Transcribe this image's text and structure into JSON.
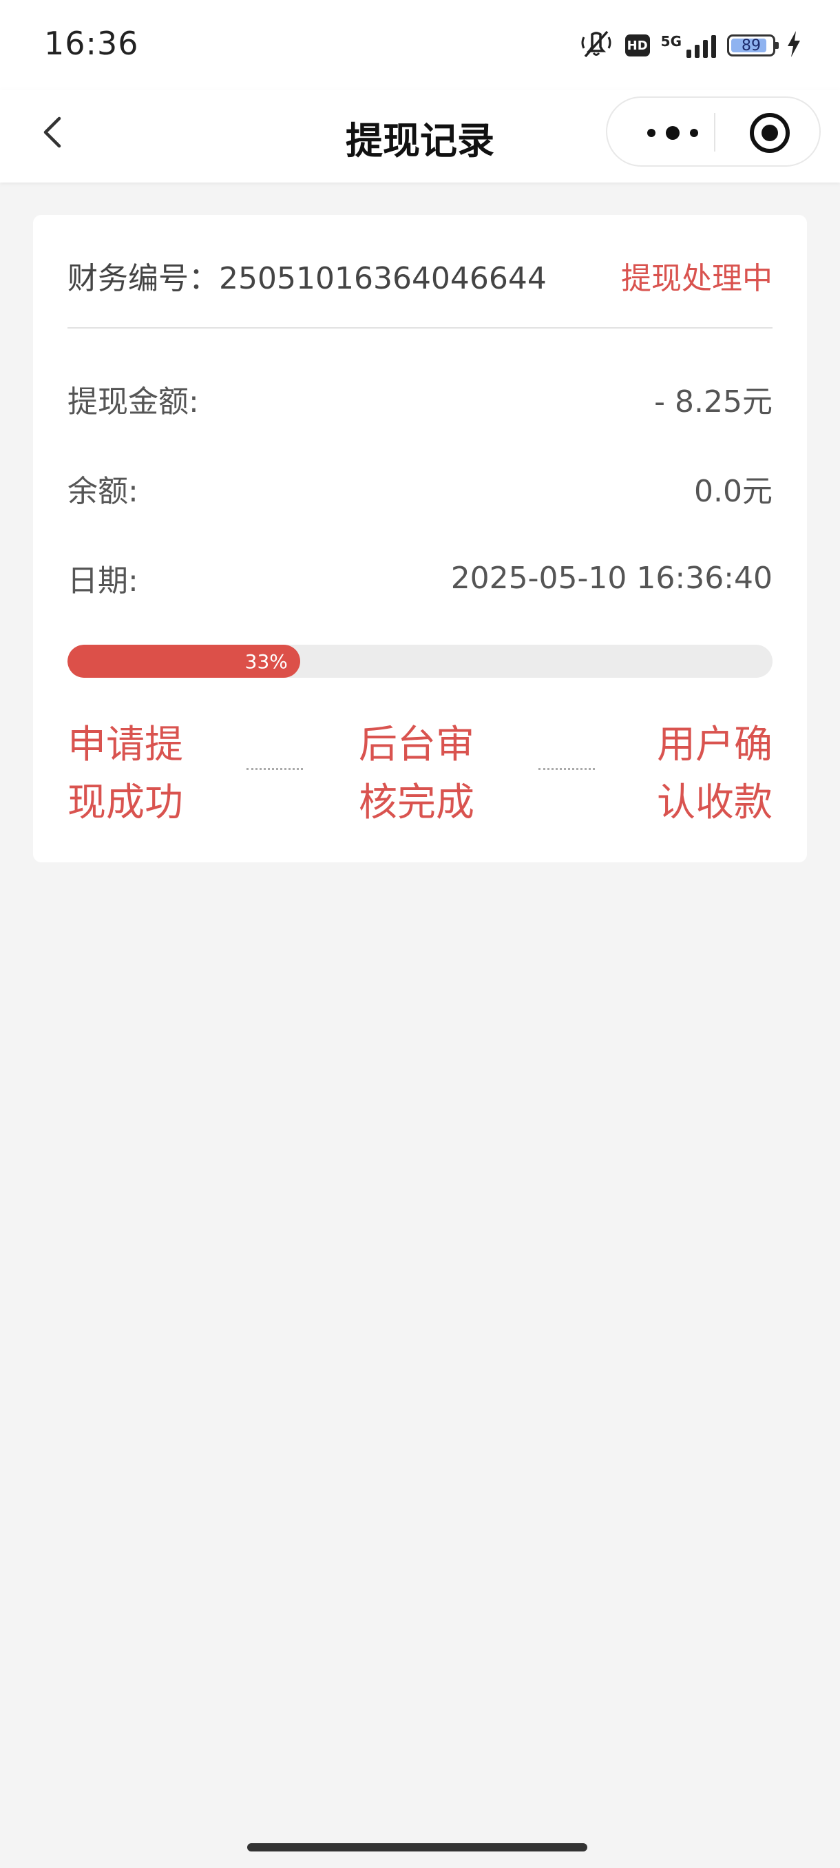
{
  "status_bar": {
    "time": "16:36",
    "icons": [
      "mute-vibrate-icon",
      "hd-icon",
      "5g-signal-icon",
      "battery-icon",
      "charging-icon"
    ],
    "hd_label": "HD",
    "network": "5G",
    "battery_level": "89"
  },
  "nav": {
    "title": "提现记录",
    "back_icon": "chevron-left-icon",
    "more_icon": "more-dots-icon",
    "close_icon": "target-circle-icon"
  },
  "record": {
    "finance_label": "财务编号：",
    "finance_number": "25051016364046644",
    "status": "提现处理中",
    "amount_label": "提现金额:",
    "amount_value": "- 8.25元",
    "balance_label": "余额:",
    "balance_value": "0.0元",
    "date_label": "日期:",
    "date_value": "2025-05-10 16:36:40",
    "progress_percent": 33,
    "progress_text": "33%",
    "steps": [
      {
        "line1": "申请提",
        "line2": "现成功"
      },
      {
        "line1": "后台审",
        "line2": "核完成"
      },
      {
        "line1": "用户确",
        "line2": "认收款"
      }
    ]
  },
  "colors": {
    "accent_red": "#d9534f",
    "progress_fill": "#dc5049",
    "progress_track": "#ececec",
    "page_background": "#f4f4f4",
    "battery_fill": "#8fb3f0"
  }
}
